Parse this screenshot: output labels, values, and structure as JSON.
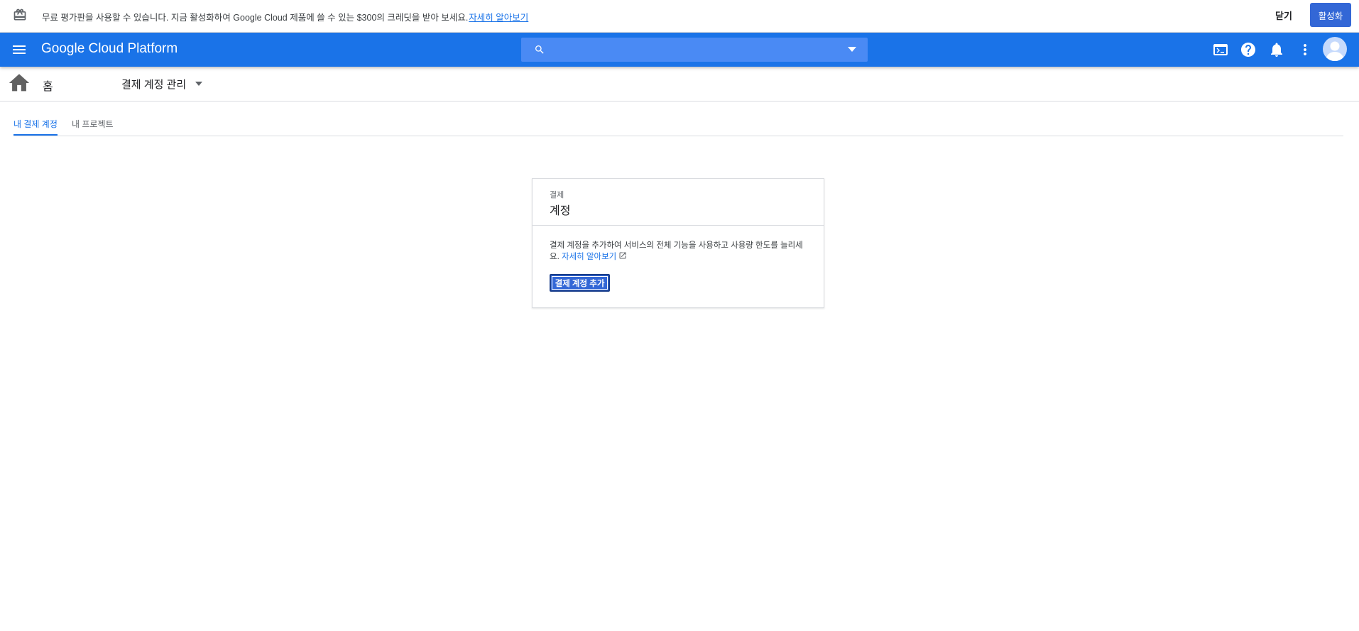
{
  "banner": {
    "message": "무료 평가판을 사용할 수 있습니다. 지금 활성화하여 Google Cloud 제품에 쓸 수 있는 $300의 크레딧을 받아 보세요.",
    "learn_more": "자세히 알아보기",
    "close_label": "닫기",
    "activate_label": "활성화"
  },
  "header": {
    "brand": "Google Cloud Platform",
    "search_placeholder": "",
    "icons": [
      "menu-icon",
      "search-icon",
      "cloud-shell-icon",
      "help-icon",
      "notifications-icon",
      "more-vert-icon",
      "account-icon"
    ]
  },
  "breadcrumb": {
    "home_label": "홈",
    "account_select": "결제 계정 관리"
  },
  "tabs": [
    {
      "label": "내 결제 계정",
      "active": true
    },
    {
      "label": "내 프로젝트",
      "active": false
    }
  ],
  "card": {
    "supertitle": "결제",
    "title": "계정",
    "description": "결제 계정을 추가하여 서비스의 전체 기능을 사용하고 사용량 한도를 늘리세요.",
    "learn_more": "자세히 알아보기",
    "add_button": "결제 계정 추가"
  },
  "colors": {
    "accent": "#1a73e8",
    "button": "#3367d6"
  }
}
